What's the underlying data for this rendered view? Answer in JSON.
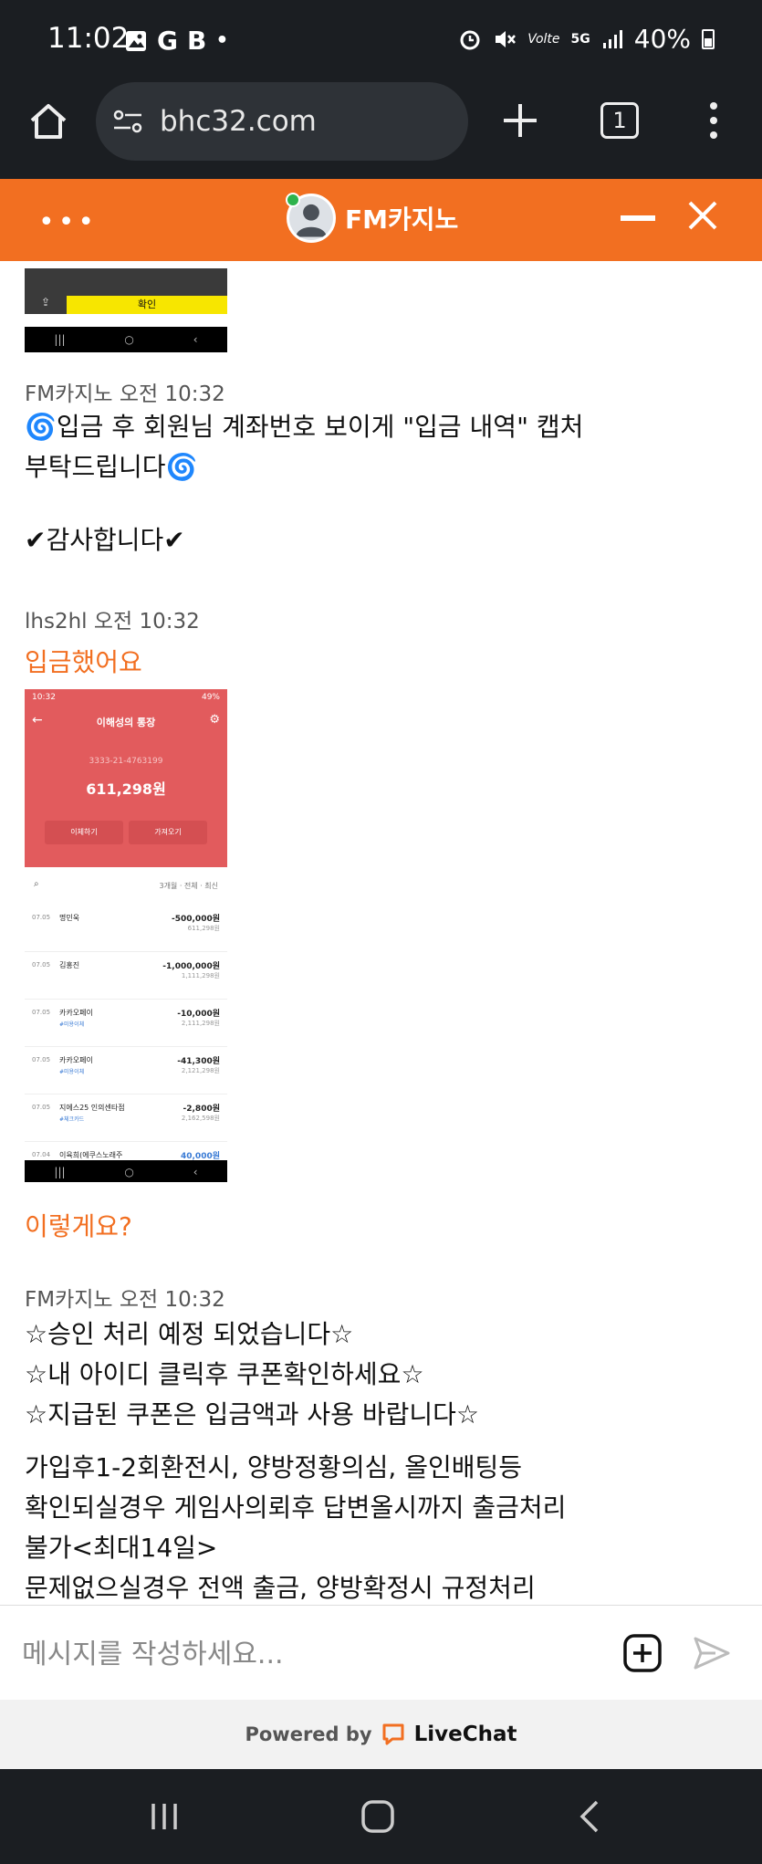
{
  "status_bar": {
    "time": "11:02",
    "left_icons": [
      "image-icon",
      "google-icon",
      "b-icon",
      "dot-icon"
    ],
    "right_icons": [
      "alarm-icon",
      "mute-icon",
      "volte-icon",
      "5g-icon",
      "signal-icon"
    ],
    "battery": "40%"
  },
  "browser": {
    "url": "bhc32.com",
    "tab_count": "1"
  },
  "chat_header": {
    "agent_name": "FM카지노"
  },
  "messages": [
    {
      "author": "FM카지노",
      "time": "오전 10:32",
      "lines": [
        "🌀입금 후 회원님 계좌번호 보이게 \"입금 내역\" 캡처",
        "부탁드립니다🌀",
        "",
        "✔감사합니다✔"
      ]
    },
    {
      "author": "lhs2hl",
      "time": "오전 10:32",
      "text": "입금했어요"
    },
    {
      "text": "이렇게요?"
    },
    {
      "author": "FM카지노",
      "time": "오전 10:32",
      "lines": [
        "☆승인 처리 예정 되었습니다☆",
        "☆내 아이디 클릭후 쿠폰확인하세요☆",
        "☆지급된 쿠폰은 입금액과 사용 바랍니다☆"
      ]
    },
    {
      "lines": [
        "가입후1-2회환전시, 양방정황의심, 올인배팅등",
        "확인되실경우 게임사의뢰후 답변올시까지 출금처리",
        "불가<최대14일>",
        "문제없으실경우 전액 출금, 양방확정시 규정처리"
      ]
    }
  ],
  "top_image": {
    "confirm_label": "확인"
  },
  "bank_screenshot": {
    "status_time": "10:32",
    "status_battery": "49%",
    "title": "이해성의 통장",
    "account": "3333-21-4763199",
    "balance": "611,298원",
    "buttons": [
      "이체하기",
      "가져오기"
    ],
    "filter": "3개월 · 전체 · 최신",
    "transactions": [
      {
        "date": "07.05",
        "name": "명민욱",
        "tag": "",
        "amount": "-500,000원",
        "balance": "611,298원"
      },
      {
        "date": "07.05",
        "name": "김홍진",
        "tag": "",
        "amount": "-1,000,000원",
        "balance": "1,111,298원"
      },
      {
        "date": "07.05",
        "name": "카카오페이",
        "tag": "#미용이체",
        "amount": "-10,000원",
        "balance": "2,111,298원"
      },
      {
        "date": "07.05",
        "name": "카카오페이",
        "tag": "#미용이체",
        "amount": "-41,300원",
        "balance": "2,121,298원"
      },
      {
        "date": "07.05",
        "name": "지에스25 인의센타점",
        "tag": "#체크카드",
        "amount": "-2,800원",
        "balance": "2,162,598원"
      },
      {
        "date": "07.04",
        "name": "이육희(에쿠스노래주",
        "tag": "",
        "amount": "40,000원",
        "balance": ""
      }
    ]
  },
  "composer": {
    "placeholder": "메시지를 작성하세요..."
  },
  "footer": {
    "powered_by": "Powered by",
    "brand": "LiveChat"
  },
  "colors": {
    "accent": "#f26f21",
    "dark": "#1b1e22",
    "bank_red": "#e25b5d",
    "yellow": "#f7e600"
  }
}
